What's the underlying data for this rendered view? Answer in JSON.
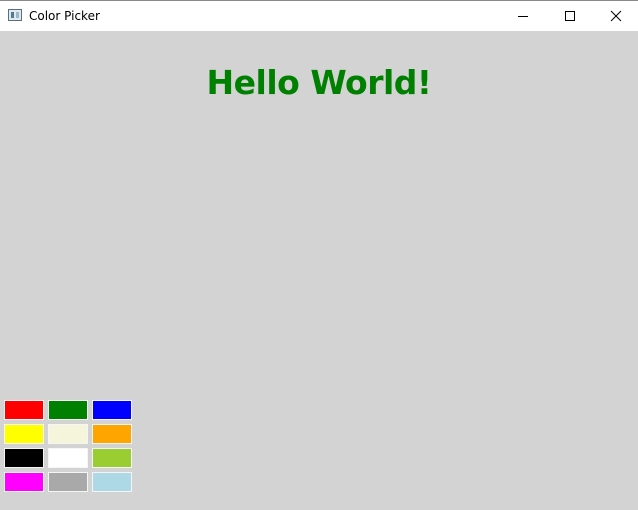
{
  "window": {
    "title": "Color Picker"
  },
  "heading": {
    "text": "Hello World!",
    "color": "#008000"
  },
  "swatches": [
    {
      "name": "red",
      "color": "#ff0000"
    },
    {
      "name": "green",
      "color": "#008000"
    },
    {
      "name": "blue",
      "color": "#0000ff"
    },
    {
      "name": "yellow",
      "color": "#ffff00"
    },
    {
      "name": "beige",
      "color": "#f5f5dc"
    },
    {
      "name": "orange",
      "color": "#ffa500"
    },
    {
      "name": "black",
      "color": "#000000"
    },
    {
      "name": "white",
      "color": "#ffffff"
    },
    {
      "name": "yellowgreen",
      "color": "#9acd32"
    },
    {
      "name": "magenta",
      "color": "#ff00ff"
    },
    {
      "name": "darkgray",
      "color": "#a9a9a9"
    },
    {
      "name": "lightblue",
      "color": "#add8e6"
    }
  ],
  "background_color": "#d3d3d3"
}
